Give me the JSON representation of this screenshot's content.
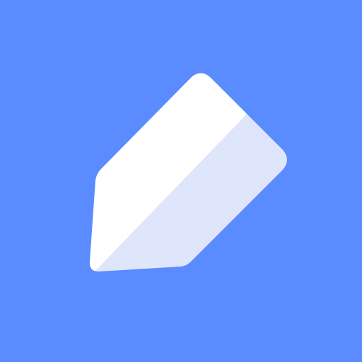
{
  "icon": {
    "name": "pencil-icon",
    "colors": {
      "background": "#5a8bff",
      "shape_light": "#ffffff",
      "shape_shade": "#dfe6fb"
    }
  }
}
